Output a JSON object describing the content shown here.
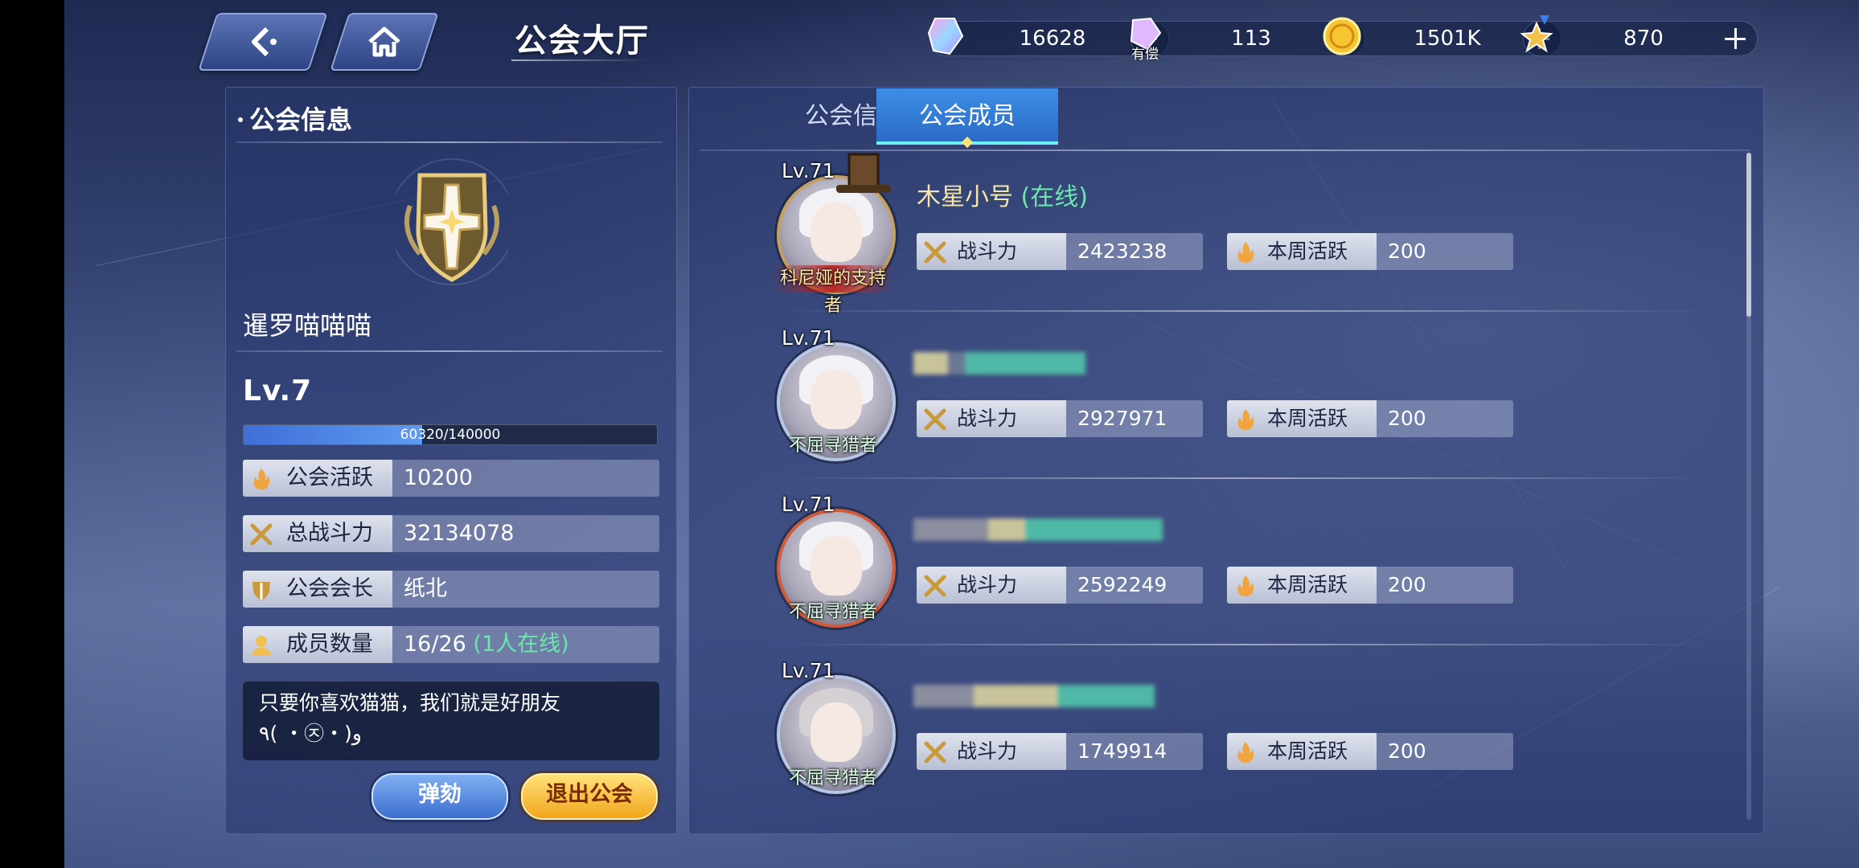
{
  "header": {
    "back_icon": "back-arrow-icon",
    "home_icon": "home-icon",
    "title": "公会大厅"
  },
  "resources": [
    {
      "name": "crystal",
      "icon": "rainbow-crystal-icon",
      "value": "16628"
    },
    {
      "name": "paid-crystal",
      "icon": "paid-crystal-icon",
      "tag": "有偿",
      "value": "113"
    },
    {
      "name": "gold",
      "icon": "gold-coin-icon",
      "value": "1501K"
    },
    {
      "name": "medal",
      "icon": "star-medal-icon",
      "value": "870"
    }
  ],
  "left_panel": {
    "section_title": "公会信息",
    "guild_emblem": "cross-shield-emblem-icon",
    "guild_name": "暹罗喵喵喵",
    "level": "Lv.7",
    "xp_text": "60320/140000",
    "xp_fraction": 0.431,
    "stats": [
      {
        "icon": "flame-icon",
        "label": "公会活跃",
        "value": "10200"
      },
      {
        "icon": "swords-icon",
        "label": "总战斗力",
        "value": "32134078"
      },
      {
        "icon": "shield-icon",
        "label": "公会会长",
        "value": "纸北"
      },
      {
        "icon": "person-icon",
        "label": "成员数量",
        "value": "16/26",
        "extra": "(1人在线)"
      }
    ],
    "motto_line1": "只要你喜欢猫猫，我们就是好朋友",
    "motto_line2": "٩( ・㉨・)و",
    "kick_button": "弹劾",
    "leave_button": "退出公会"
  },
  "tabs": {
    "info": "公会信息",
    "members": "公会成员"
  },
  "members": [
    {
      "level": "Lv.71",
      "title_badge": "科尼娅的支持者",
      "name": "木星小号",
      "status": "(在线)",
      "power_label": "战斗力",
      "power": "2423238",
      "activity_label": "本周活跃",
      "activity": "200"
    },
    {
      "level": "Lv.71",
      "title_badge": "不屈寻猎者",
      "name": "",
      "status": "",
      "power_label": "战斗力",
      "power": "2927971",
      "activity_label": "本周活跃",
      "activity": "200"
    },
    {
      "level": "Lv.71",
      "title_badge": "不屈寻猎者",
      "name": "",
      "status": "",
      "power_label": "战斗力",
      "power": "2592249",
      "activity_label": "本周活跃",
      "activity": "200"
    },
    {
      "level": "Lv.71",
      "title_badge": "不屈寻猎者",
      "name": "",
      "status": "",
      "power_label": "战斗力",
      "power": "1749914",
      "activity_label": "本周活跃",
      "activity": "200"
    }
  ],
  "colors": {
    "accent": "#3d8ee6",
    "online": "#6be7ae",
    "gold": "#f2a51c"
  }
}
